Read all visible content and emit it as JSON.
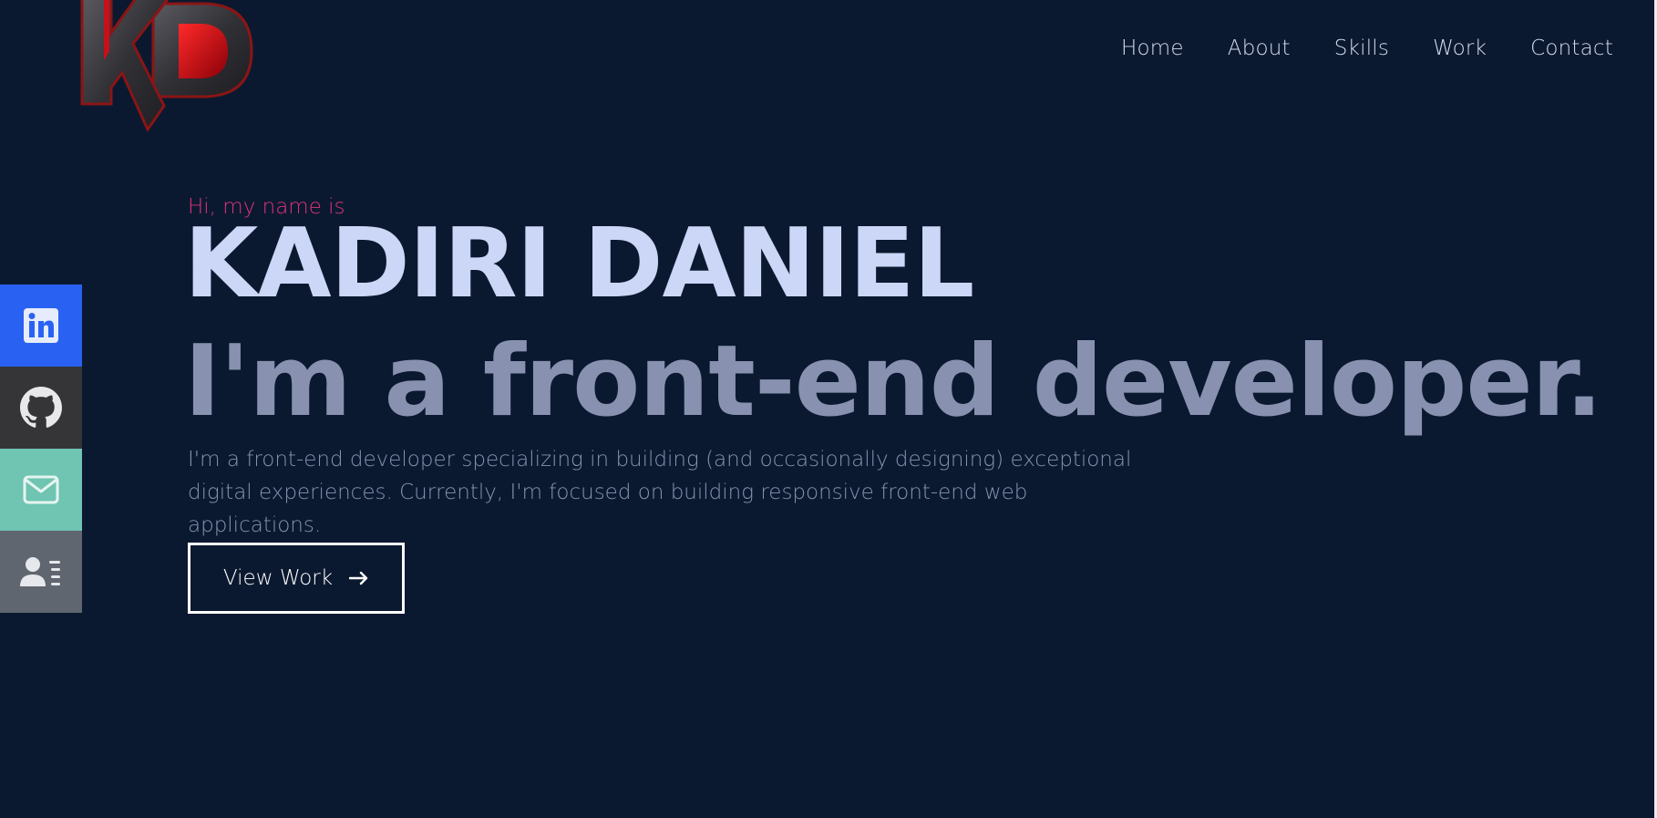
{
  "logo": {
    "text": "KD",
    "colors": {
      "dark": "#3a3a3f",
      "red": "#d5101a"
    }
  },
  "nav": {
    "items": [
      {
        "label": "Home"
      },
      {
        "label": "About"
      },
      {
        "label": "Skills"
      },
      {
        "label": "Work"
      },
      {
        "label": "Contact"
      }
    ]
  },
  "social": {
    "items": [
      {
        "icon": "linkedin-icon",
        "color": "#2962f3"
      },
      {
        "icon": "github-icon",
        "color": "#353537"
      },
      {
        "icon": "mail-icon",
        "color": "#6fc4b2"
      },
      {
        "icon": "resume-icon",
        "color": "#5f6670"
      }
    ]
  },
  "hero": {
    "greeting": "Hi, my name is",
    "name": "KADIRI DANIEL",
    "tagline": "I'm a front-end developer.",
    "intro_line1": "I'm a front-end developer specializing in building (and occasionally designing) exceptional",
    "intro_line2": "digital experiences. Currently, I'm focused on building responsive front-end web applications.",
    "cta_label": "View Work",
    "cta_icon": "arrow-right-icon"
  },
  "colors": {
    "background": "#0b1930",
    "accent": "#e0327a",
    "heading": "#ccd6f6",
    "muted": "#8892b0"
  }
}
